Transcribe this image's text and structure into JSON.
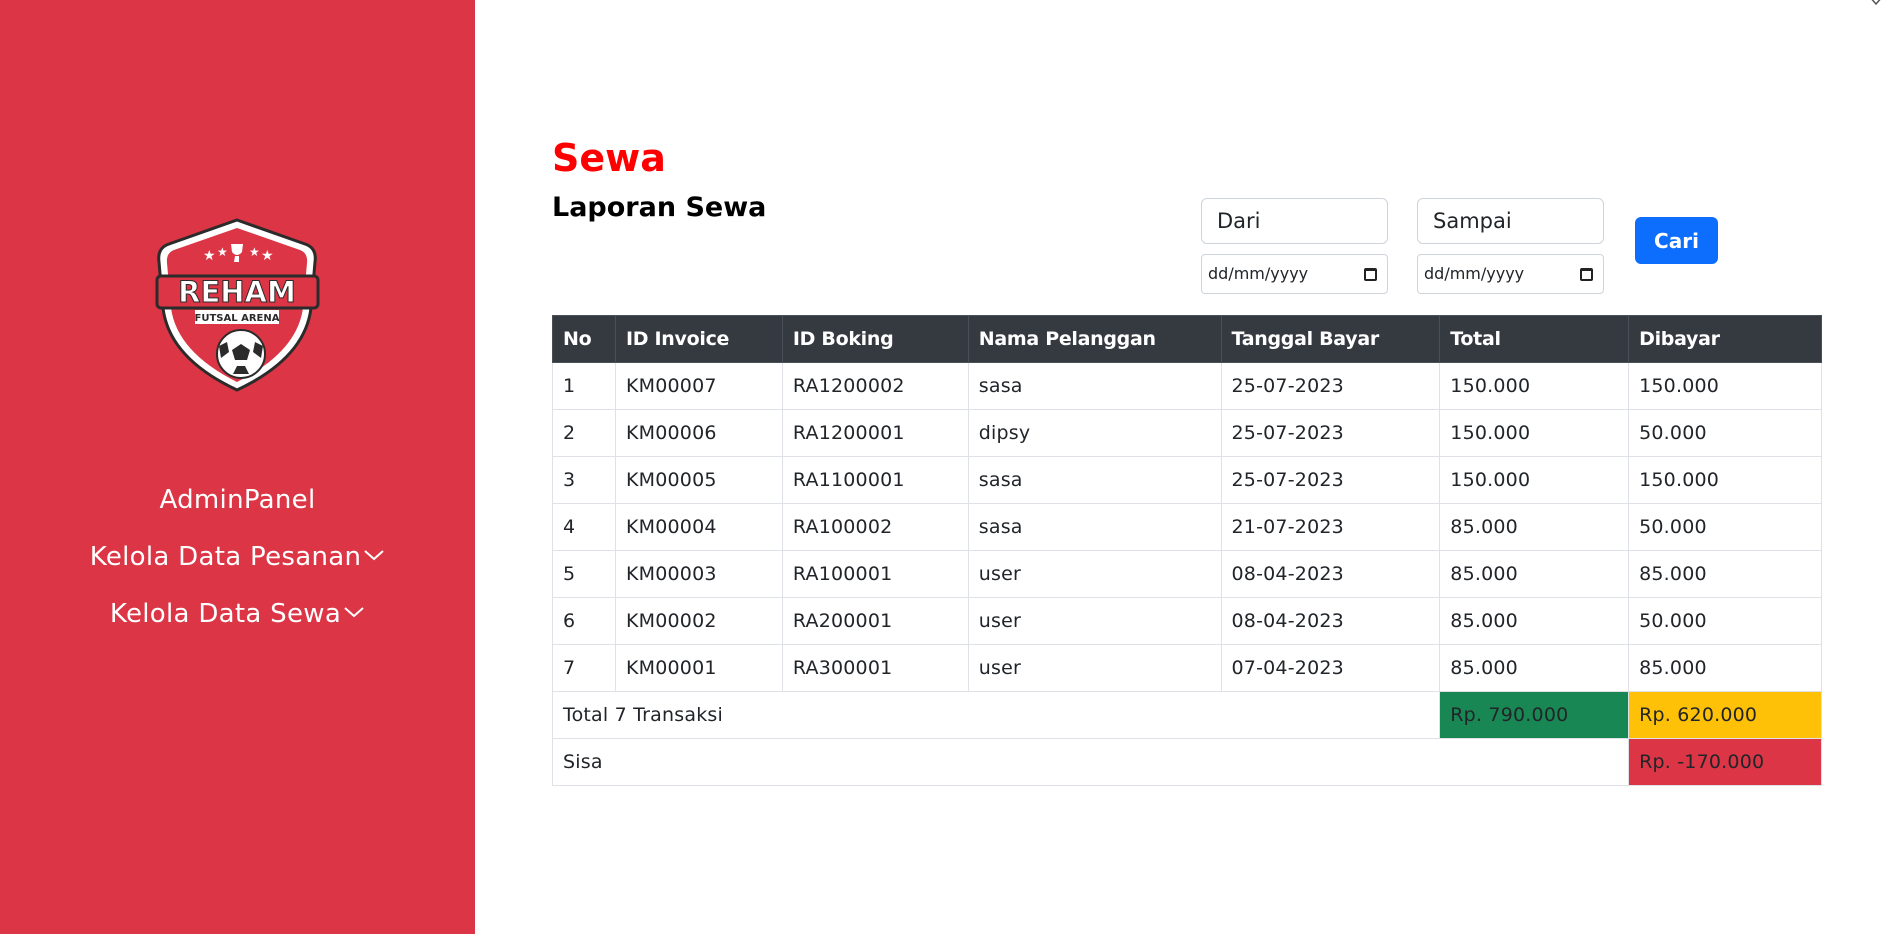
{
  "sidebar": {
    "logo": {
      "main": "REHAM",
      "sub": "FUTSAL ARENA"
    },
    "items": [
      {
        "label": "AdminPanel",
        "has_chevron": false
      },
      {
        "label": "Kelola Data Pesanan",
        "has_chevron": true
      },
      {
        "label": "Kelola Data Sewa",
        "has_chevron": true
      }
    ]
  },
  "page": {
    "title": "Sewa",
    "subtitle": "Laporan Sewa"
  },
  "filter": {
    "from_label": "Dari",
    "to_label": "Sampai",
    "from_date_placeholder": "dd/mm/yyyy",
    "to_date_placeholder": "dd/mm/yyyy",
    "search_button": "Cari"
  },
  "table": {
    "headers": [
      "No",
      "ID Invoice",
      "ID Boking",
      "Nama Pelanggan",
      "Tanggal Bayar",
      "Total",
      "Dibayar"
    ],
    "rows": [
      [
        "1",
        "KM00007",
        "RA1200002",
        "sasa",
        "25-07-2023",
        "150.000",
        "150.000"
      ],
      [
        "2",
        "KM00006",
        "RA1200001",
        "dipsy",
        "25-07-2023",
        "150.000",
        "50.000"
      ],
      [
        "3",
        "KM00005",
        "RA1100001",
        "sasa",
        "25-07-2023",
        "150.000",
        "150.000"
      ],
      [
        "4",
        "KM00004",
        "RA100002",
        "sasa",
        "21-07-2023",
        "85.000",
        "50.000"
      ],
      [
        "5",
        "KM00003",
        "RA100001",
        "user",
        "08-04-2023",
        "85.000",
        "85.000"
      ],
      [
        "6",
        "KM00002",
        "RA200001",
        "user",
        "08-04-2023",
        "85.000",
        "50.000"
      ],
      [
        "7",
        "KM00001",
        "RA300001",
        "user",
        "07-04-2023",
        "85.000",
        "85.000"
      ]
    ],
    "total_label": "Total 7 Transaksi",
    "total_amount": "Rp. 790.000",
    "paid_amount": "Rp. 620.000",
    "remainder_label": "Sisa",
    "remainder_amount": "Rp. -170.000"
  },
  "colors": {
    "sidebar": "#dc3545",
    "title": "#ff0000",
    "button": "#0d6efd",
    "total": "#198754",
    "paid": "#ffc107",
    "remainder": "#dc3545"
  }
}
